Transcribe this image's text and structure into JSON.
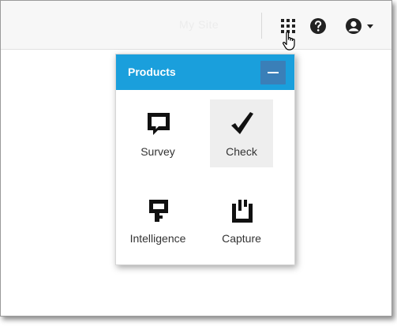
{
  "topbar": {
    "ghost_text": "My Site",
    "icons": [
      "apps-grid-icon",
      "help-icon",
      "account-icon",
      "caret-down-icon"
    ]
  },
  "products_panel": {
    "title": "Products",
    "collapse_icon": "minus-icon",
    "header_color": "#1a9fdc",
    "items": [
      {
        "label": "Survey",
        "icon": "survey-icon",
        "active": false
      },
      {
        "label": "Check",
        "icon": "check-icon",
        "active": true
      },
      {
        "label": "Intelligence",
        "icon": "intelligence-icon",
        "active": false
      },
      {
        "label": "Capture",
        "icon": "capture-icon",
        "active": false
      }
    ]
  }
}
